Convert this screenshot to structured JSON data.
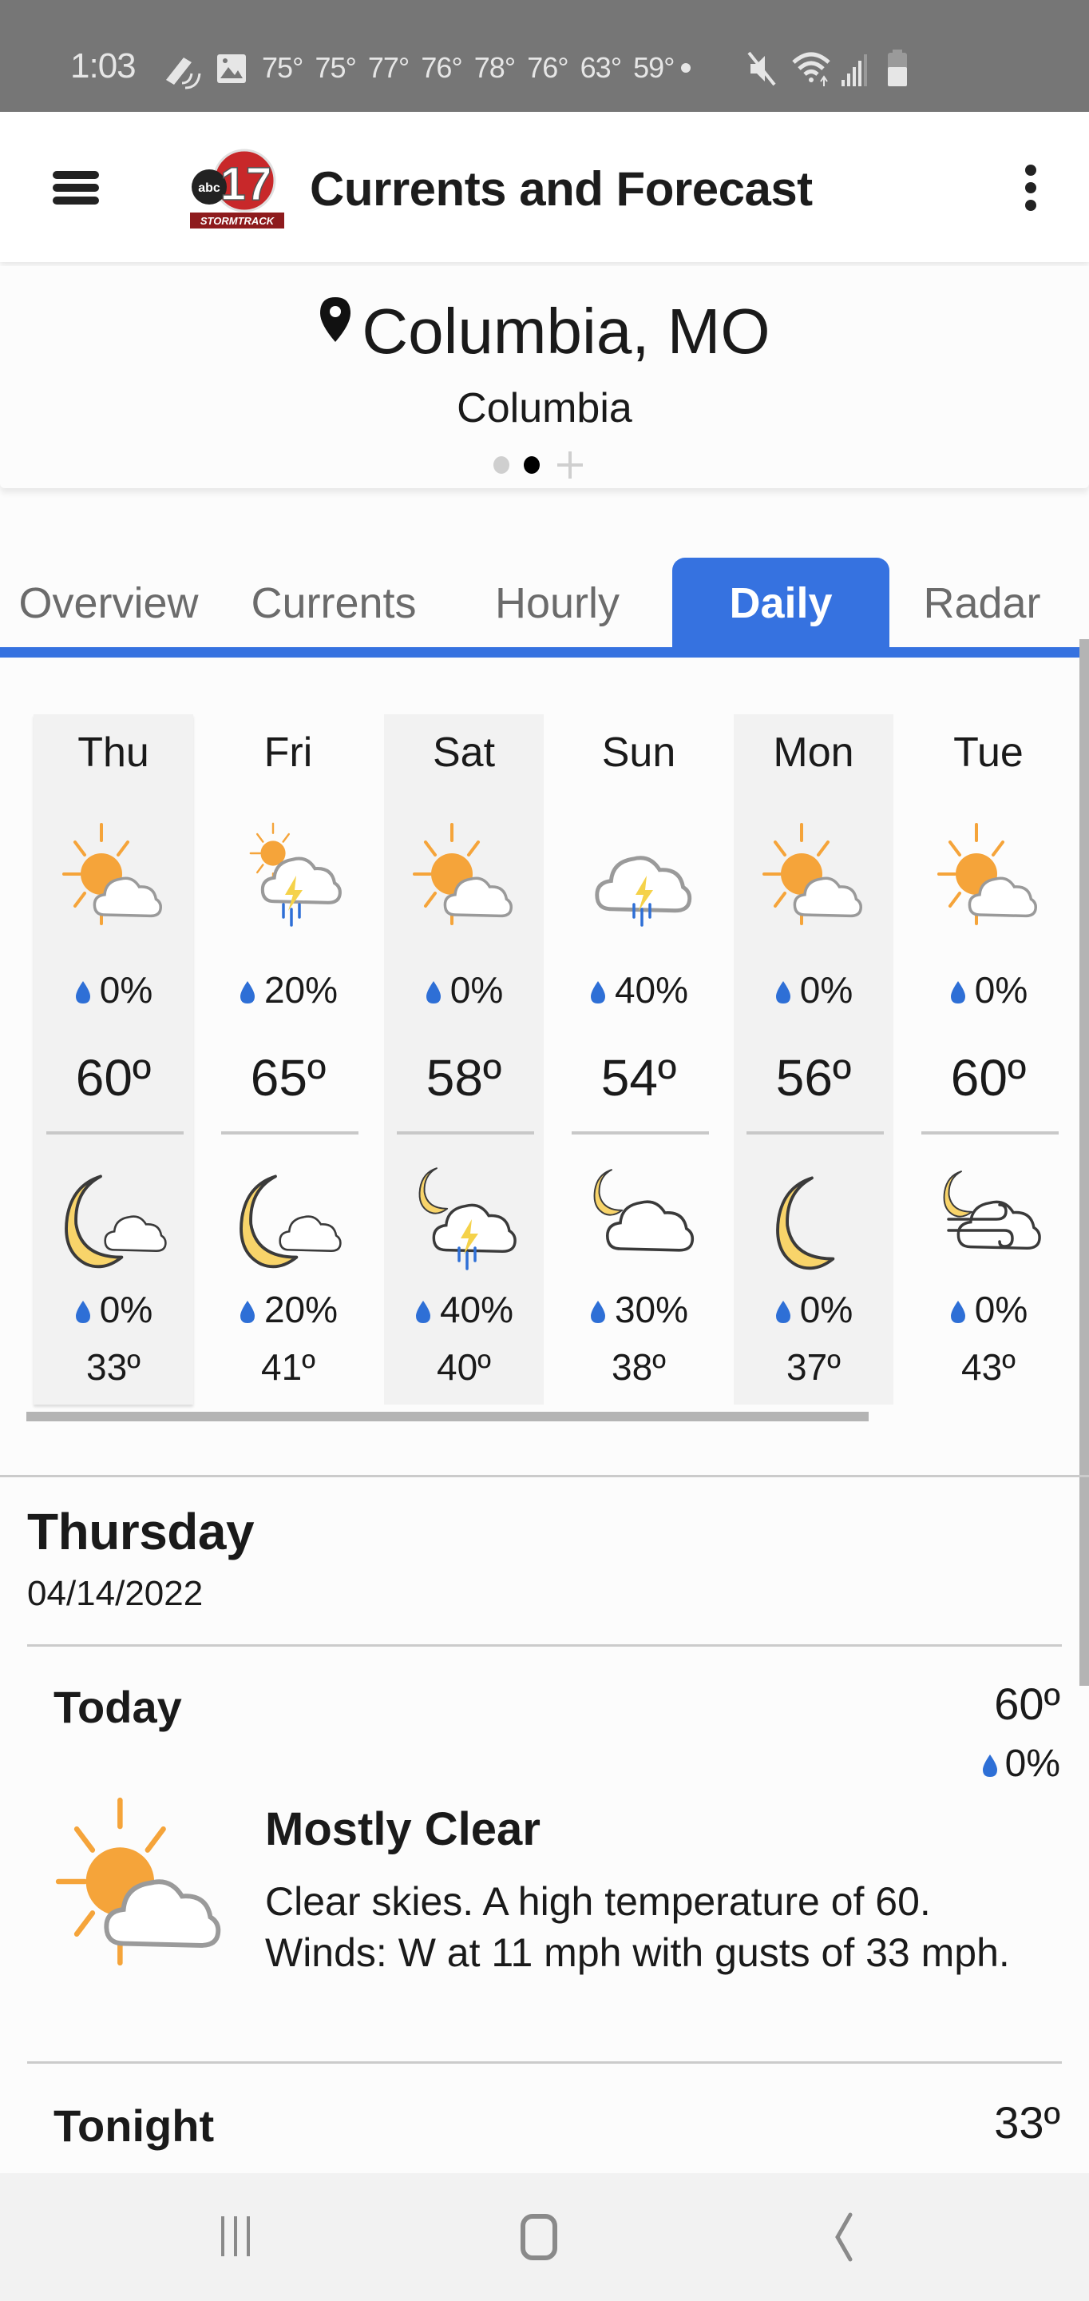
{
  "status_bar": {
    "time": "1:03",
    "notification_temps": "75° 75° 77° 76° 78° 76° 63° 59°",
    "icons": [
      "sync-icon",
      "image-icon",
      "mute-icon",
      "wifi-icon",
      "signal-icon",
      "battery-icon"
    ]
  },
  "app_bar": {
    "title": "Currents and Forecast",
    "logo_text": "abc 17 STORMTRACK",
    "logo_channel": "17",
    "logo_brand": "STORMTRACK",
    "menu_icon": "hamburger-icon",
    "overflow_icon": "more-vert-icon"
  },
  "location": {
    "title": "Columbia, MO",
    "subtitle": "Columbia",
    "page_count": 2,
    "active_page": 2
  },
  "tabs": [
    {
      "label": "Overview",
      "active": false
    },
    {
      "label": "Currents",
      "active": false
    },
    {
      "label": "Hourly",
      "active": false
    },
    {
      "label": "Daily",
      "active": true
    },
    {
      "label": "Radar",
      "active": false
    }
  ],
  "colors": {
    "accent": "#3672e0",
    "sun": "#f5a43a",
    "moon": "#f8d46a",
    "rain": "#2e6fd6",
    "bolt": "#f5d24a",
    "cloud_stroke": "#9a9a9a"
  },
  "daily": [
    {
      "day": "Thu",
      "day_icon": "partly-sunny",
      "day_precip": "0%",
      "high": "60º",
      "night_icon": "moon-cloud",
      "night_precip": "0%",
      "low": "33º"
    },
    {
      "day": "Fri",
      "day_icon": "sun-thunderstorm",
      "day_precip": "20%",
      "high": "65º",
      "night_icon": "moon-cloud",
      "night_precip": "20%",
      "low": "41º"
    },
    {
      "day": "Sat",
      "day_icon": "partly-sunny",
      "day_precip": "0%",
      "high": "58º",
      "night_icon": "moon-thunderstorm",
      "night_precip": "40%",
      "low": "40º"
    },
    {
      "day": "Sun",
      "day_icon": "thunderstorm",
      "day_precip": "40%",
      "high": "54º",
      "night_icon": "moon-cloudy",
      "night_precip": "30%",
      "low": "38º"
    },
    {
      "day": "Mon",
      "day_icon": "partly-sunny",
      "day_precip": "0%",
      "high": "56º",
      "night_icon": "moon",
      "night_precip": "0%",
      "low": "37º"
    },
    {
      "day": "Tue",
      "day_icon": "partly-sunny",
      "day_precip": "0%",
      "high": "60º",
      "night_icon": "moon-windy",
      "night_precip": "0%",
      "low": "43º"
    }
  ],
  "detail": {
    "day": "Thursday",
    "date": "04/14/2022",
    "periods": [
      {
        "name": "Today",
        "temp": "60º",
        "precip": "0%",
        "icon": "partly-sunny",
        "condition": "Mostly Clear",
        "description": "Clear skies.  A high temperature of 60. Winds: W at 11 mph with gusts of 33 mph."
      },
      {
        "name": "Tonight",
        "temp": "33º"
      }
    ]
  },
  "nav_bar": {
    "recents": "recents-icon",
    "home": "home-icon",
    "back": "back-icon"
  }
}
